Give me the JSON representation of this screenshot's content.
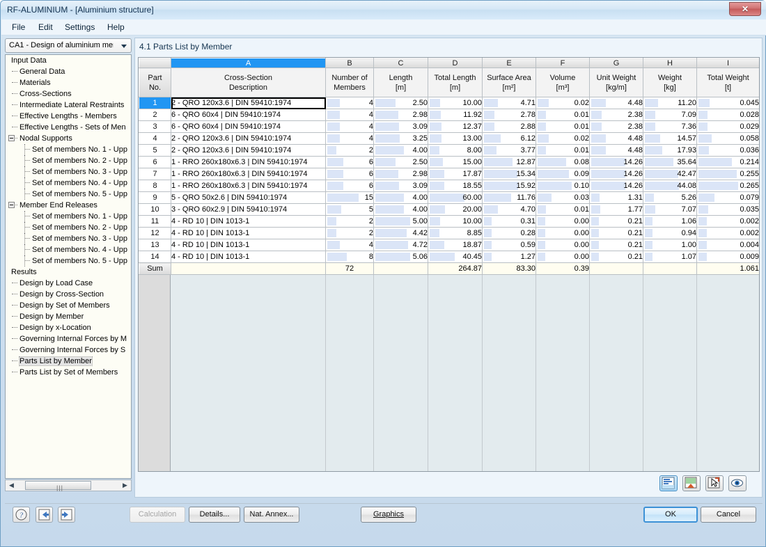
{
  "window": {
    "title": "RF-ALUMINIUM - [Aluminium structure]",
    "close_label": "✕"
  },
  "menubar": {
    "items": [
      {
        "label": "File"
      },
      {
        "label": "Edit"
      },
      {
        "label": "Settings"
      },
      {
        "label": "Help"
      }
    ]
  },
  "sidebar": {
    "combo": {
      "value": "CA1 - Design of aluminium meml"
    },
    "tree": [
      {
        "label": "Input Data",
        "level": "root"
      },
      {
        "label": "General Data",
        "level": "lvl1"
      },
      {
        "label": "Materials",
        "level": "lvl1"
      },
      {
        "label": "Cross-Sections",
        "level": "lvl1"
      },
      {
        "label": "Intermediate Lateral Restraints",
        "level": "lvl1"
      },
      {
        "label": "Effective Lengths - Members",
        "level": "lvl1"
      },
      {
        "label": "Effective Lengths - Sets of Men",
        "level": "lvl1"
      },
      {
        "label": "Nodal Supports",
        "level": "grp",
        "expander": true
      },
      {
        "label": "Set of members No. 1 - Upp",
        "level": "lvl2"
      },
      {
        "label": "Set of members No. 2 - Upp",
        "level": "lvl2"
      },
      {
        "label": "Set of members No. 3 - Upp",
        "level": "lvl2"
      },
      {
        "label": "Set of members No. 4 - Upp",
        "level": "lvl2"
      },
      {
        "label": "Set of members No. 5 - Upp",
        "level": "lvl2"
      },
      {
        "label": "Member End Releases",
        "level": "grp",
        "expander": true
      },
      {
        "label": "Set of members No. 1 - Upp",
        "level": "lvl2"
      },
      {
        "label": "Set of members No. 2 - Upp",
        "level": "lvl2"
      },
      {
        "label": "Set of members No. 3 - Upp",
        "level": "lvl2"
      },
      {
        "label": "Set of members No. 4 - Upp",
        "level": "lvl2"
      },
      {
        "label": "Set of members No. 5 - Upp",
        "level": "lvl2"
      },
      {
        "label": "Results",
        "level": "root"
      },
      {
        "label": "Design by Load Case",
        "level": "lvl1"
      },
      {
        "label": "Design by Cross-Section",
        "level": "lvl1"
      },
      {
        "label": "Design by Set of Members",
        "level": "lvl1"
      },
      {
        "label": "Design by Member",
        "level": "lvl1"
      },
      {
        "label": "Design by x-Location",
        "level": "lvl1"
      },
      {
        "label": "Governing Internal Forces by M",
        "level": "lvl1"
      },
      {
        "label": "Governing Internal Forces by S",
        "level": "lvl1"
      },
      {
        "label": "Parts List by Member",
        "level": "lvl1",
        "selected": true
      },
      {
        "label": "Parts List by Set of Members",
        "level": "lvl1"
      }
    ]
  },
  "main": {
    "pane_title": "4.1 Parts List by Member",
    "column_letters": [
      "",
      "A",
      "B",
      "C",
      "D",
      "E",
      "F",
      "G",
      "H",
      "I"
    ],
    "selected_letter": "A",
    "headers": [
      {
        "line1": "Part",
        "line2": "No.",
        "line3": ""
      },
      {
        "line1": "Cross-Section",
        "line2": "Description",
        "line3": ""
      },
      {
        "line1": "Number of",
        "line2": "Members",
        "line3": ""
      },
      {
        "line1": "Length",
        "line2": "[m]",
        "line3": ""
      },
      {
        "line1": "Total Length",
        "line2": "[m]",
        "line3": ""
      },
      {
        "line1": "Surface Area",
        "line2": "[m²]",
        "line3": ""
      },
      {
        "line1": "Volume",
        "line2": "[m³]",
        "line3": ""
      },
      {
        "line1": "Unit Weight",
        "line2": "[kg/m]",
        "line3": ""
      },
      {
        "line1": "Weight",
        "line2": "[kg]",
        "line3": ""
      },
      {
        "line1": "Total Weight",
        "line2": "[t]",
        "line3": ""
      }
    ],
    "rows": [
      {
        "no": "1",
        "desc": "2 - QRO 120x3.6 | DIN 59410:1974",
        "members": "4",
        "length": "2.50",
        "total_length": "10.00",
        "surface": "4.71",
        "volume": "0.02",
        "unit_weight": "4.48",
        "weight": "11.20",
        "total_weight": "0.045"
      },
      {
        "no": "2",
        "desc": "6 - QRO 60x4 | DIN 59410:1974",
        "members": "4",
        "length": "2.98",
        "total_length": "11.92",
        "surface": "2.78",
        "volume": "0.01",
        "unit_weight": "2.38",
        "weight": "7.09",
        "total_weight": "0.028"
      },
      {
        "no": "3",
        "desc": "6 - QRO 60x4 | DIN 59410:1974",
        "members": "4",
        "length": "3.09",
        "total_length": "12.37",
        "surface": "2.88",
        "volume": "0.01",
        "unit_weight": "2.38",
        "weight": "7.36",
        "total_weight": "0.029"
      },
      {
        "no": "4",
        "desc": "2 - QRO 120x3.6 | DIN 59410:1974",
        "members": "4",
        "length": "3.25",
        "total_length": "13.00",
        "surface": "6.12",
        "volume": "0.02",
        "unit_weight": "4.48",
        "weight": "14.57",
        "total_weight": "0.058"
      },
      {
        "no": "5",
        "desc": "2 - QRO 120x3.6 | DIN 59410:1974",
        "members": "2",
        "length": "4.00",
        "total_length": "8.00",
        "surface": "3.77",
        "volume": "0.01",
        "unit_weight": "4.48",
        "weight": "17.93",
        "total_weight": "0.036"
      },
      {
        "no": "6",
        "desc": "1 - RRO 260x180x6.3 | DIN 59410:1974",
        "members": "6",
        "length": "2.50",
        "total_length": "15.00",
        "surface": "12.87",
        "volume": "0.08",
        "unit_weight": "14.26",
        "weight": "35.64",
        "total_weight": "0.214"
      },
      {
        "no": "7",
        "desc": "1 - RRO 260x180x6.3 | DIN 59410:1974",
        "members": "6",
        "length": "2.98",
        "total_length": "17.87",
        "surface": "15.34",
        "volume": "0.09",
        "unit_weight": "14.26",
        "weight": "42.47",
        "total_weight": "0.255"
      },
      {
        "no": "8",
        "desc": "1 - RRO 260x180x6.3 | DIN 59410:1974",
        "members": "6",
        "length": "3.09",
        "total_length": "18.55",
        "surface": "15.92",
        "volume": "0.10",
        "unit_weight": "14.26",
        "weight": "44.08",
        "total_weight": "0.265"
      },
      {
        "no": "9",
        "desc": "5 - QRO 50x2.6 | DIN 59410:1974",
        "members": "15",
        "length": "4.00",
        "total_length": "60.00",
        "surface": "11.76",
        "volume": "0.03",
        "unit_weight": "1.31",
        "weight": "5.26",
        "total_weight": "0.079"
      },
      {
        "no": "10",
        "desc": "3 - QRO 60x2.9 | DIN 59410:1974",
        "members": "5",
        "length": "4.00",
        "total_length": "20.00",
        "surface": "4.70",
        "volume": "0.01",
        "unit_weight": "1.77",
        "weight": "7.07",
        "total_weight": "0.035"
      },
      {
        "no": "11",
        "desc": "4 - RD 10 | DIN 1013-1",
        "members": "2",
        "length": "5.00",
        "total_length": "10.00",
        "surface": "0.31",
        "volume": "0.00",
        "unit_weight": "0.21",
        "weight": "1.06",
        "total_weight": "0.002"
      },
      {
        "no": "12",
        "desc": "4 - RD 10 | DIN 1013-1",
        "members": "2",
        "length": "4.42",
        "total_length": "8.85",
        "surface": "0.28",
        "volume": "0.00",
        "unit_weight": "0.21",
        "weight": "0.94",
        "total_weight": "0.002"
      },
      {
        "no": "13",
        "desc": "4 - RD 10 | DIN 1013-1",
        "members": "4",
        "length": "4.72",
        "total_length": "18.87",
        "surface": "0.59",
        "volume": "0.00",
        "unit_weight": "0.21",
        "weight": "1.00",
        "total_weight": "0.004"
      },
      {
        "no": "14",
        "desc": "4 - RD 10 | DIN 1013-1",
        "members": "8",
        "length": "5.06",
        "total_length": "40.45",
        "surface": "1.27",
        "volume": "0.00",
        "unit_weight": "0.21",
        "weight": "1.07",
        "total_weight": "0.009"
      }
    ],
    "sum": {
      "label": "Sum",
      "desc": "",
      "members": "72",
      "length": "",
      "total_length": "264.87",
      "surface": "83.30",
      "volume": "0.39",
      "unit_weight": "",
      "weight": "",
      "total_weight": "1.061"
    },
    "grid_toolbar": [
      {
        "name": "print-report-button"
      },
      {
        "name": "export-excel-button"
      },
      {
        "name": "select-pick-button"
      },
      {
        "name": "view-visibility-button"
      }
    ]
  },
  "footer": {
    "calculation_label": "Calculation",
    "details_label": "Details...",
    "nat_annex_label": "Nat. Annex...",
    "graphics_label": "Graphics",
    "ok_label": "OK",
    "cancel_label": "Cancel"
  },
  "colors": {
    "accent": "#2196f3",
    "bar_fill": "#dbe5f7",
    "sum_bg": "#fffdf0",
    "title_bar": "#d5e7f6"
  }
}
